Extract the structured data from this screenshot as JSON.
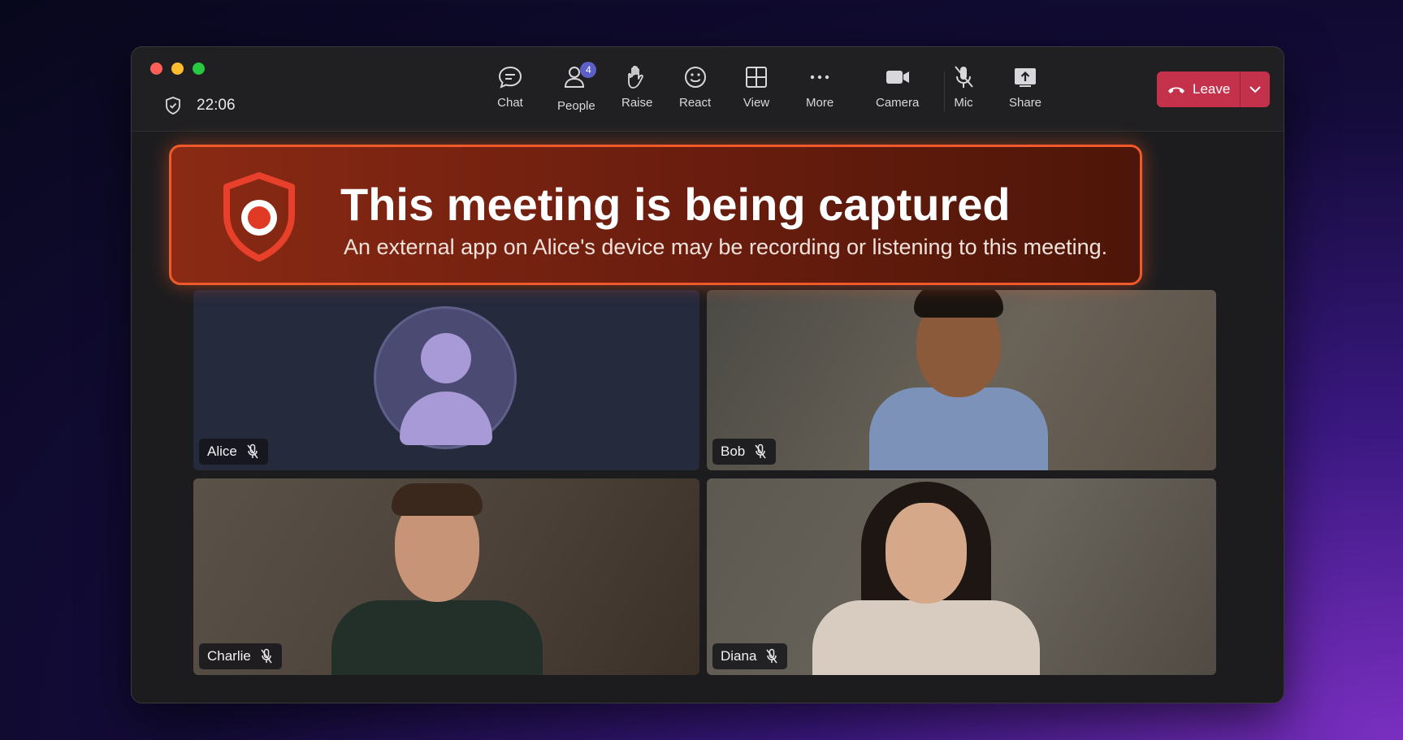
{
  "titlebar": {
    "timer": "22:06"
  },
  "toolbar": {
    "chat": "Chat",
    "people": "People",
    "people_badge": "4",
    "raise": "Raise",
    "react": "React",
    "view": "View",
    "more": "More",
    "camera": "Camera",
    "mic": "Mic",
    "share": "Share",
    "leave": "Leave"
  },
  "banner": {
    "title": "This meeting is being captured",
    "subtitle": "An external app on Alice's device may be recording or listening to this meeting."
  },
  "participants": [
    {
      "name": "Alice",
      "muted": true
    },
    {
      "name": "Bob",
      "muted": true
    },
    {
      "name": "Charlie",
      "muted": true
    },
    {
      "name": "Diana",
      "muted": true
    }
  ],
  "colors": {
    "leave": "#c4314b",
    "banner_border": "#f05a2a",
    "badge": "#5b5fc7"
  }
}
